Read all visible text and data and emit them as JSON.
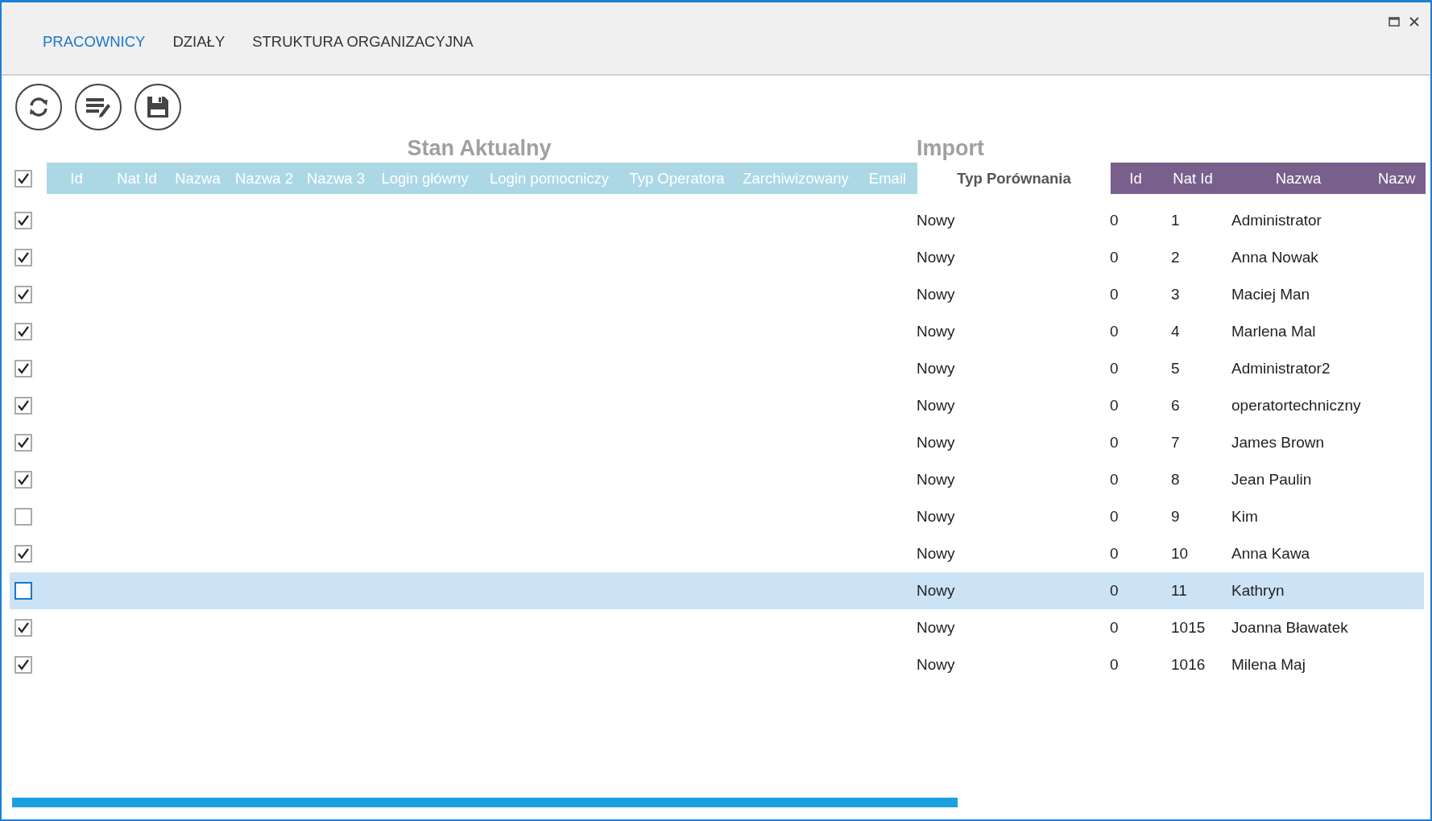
{
  "tabs": [
    {
      "label": "PRACOWNICY",
      "selected": true
    },
    {
      "label": "DZIAŁY",
      "selected": false
    },
    {
      "label": "STRUKTURA ORGANIZACYJNA",
      "selected": false
    }
  ],
  "sections": {
    "current": "Stan Aktualny",
    "import": "Import"
  },
  "header_checkbox": {
    "checked": true
  },
  "current_columns": [
    "Id",
    "Nat Id",
    "Nazwa",
    "Nazwa 2",
    "Nazwa 3",
    "Login główny",
    "Login pomocniczy",
    "Typ Operatora",
    "Zarchiwizowany",
    "Email"
  ],
  "comparison_column": "Typ Porównania",
  "import_columns": [
    "Id",
    "Nat Id",
    "Nazwa",
    "Nazw"
  ],
  "rows": [
    {
      "checked": true,
      "selected": false,
      "comparison": "Nowy",
      "id": "0",
      "nat_id": "1",
      "name": "Administrator"
    },
    {
      "checked": true,
      "selected": false,
      "comparison": "Nowy",
      "id": "0",
      "nat_id": "2",
      "name": "Anna Nowak"
    },
    {
      "checked": true,
      "selected": false,
      "comparison": "Nowy",
      "id": "0",
      "nat_id": "3",
      "name": "Maciej Man"
    },
    {
      "checked": true,
      "selected": false,
      "comparison": "Nowy",
      "id": "0",
      "nat_id": "4",
      "name": "Marlena Mal"
    },
    {
      "checked": true,
      "selected": false,
      "comparison": "Nowy",
      "id": "0",
      "nat_id": "5",
      "name": "Administrator2"
    },
    {
      "checked": true,
      "selected": false,
      "comparison": "Nowy",
      "id": "0",
      "nat_id": "6",
      "name": "operatortechniczny"
    },
    {
      "checked": true,
      "selected": false,
      "comparison": "Nowy",
      "id": "0",
      "nat_id": "7",
      "name": "James Brown"
    },
    {
      "checked": true,
      "selected": false,
      "comparison": "Nowy",
      "id": "0",
      "nat_id": "8",
      "name": "Jean Paulin"
    },
    {
      "checked": false,
      "selected": false,
      "comparison": "Nowy",
      "id": "0",
      "nat_id": "9",
      "name": "Kim"
    },
    {
      "checked": true,
      "selected": false,
      "comparison": "Nowy",
      "id": "0",
      "nat_id": "10",
      "name": "Anna Kawa"
    },
    {
      "checked": false,
      "selected": true,
      "comparison": "Nowy",
      "id": "0",
      "nat_id": "11",
      "name": "Kathryn"
    },
    {
      "checked": true,
      "selected": false,
      "comparison": "Nowy",
      "id": "0",
      "nat_id": "1015",
      "name": "Joanna Bławatek"
    },
    {
      "checked": true,
      "selected": false,
      "comparison": "Nowy",
      "id": "0",
      "nat_id": "1016",
      "name": "Milena Maj"
    }
  ]
}
